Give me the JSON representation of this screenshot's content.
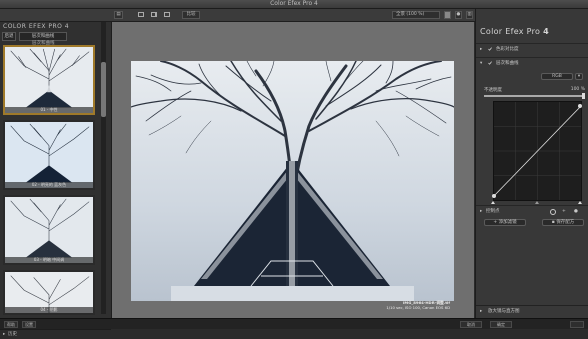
{
  "window": {
    "title": "Color Efex Pro 4"
  },
  "toolbar": {
    "compare_label": "比较",
    "zoom_label": "全景 (100 %)"
  },
  "left_panel": {
    "brand": "COLOR EFEX PRO 4",
    "back_label": "后退",
    "section_label": "层次和曲线",
    "subheading": "层次和曲线",
    "presets": [
      {
        "label": "01 - 中性",
        "selected": true
      },
      {
        "label": "02 - 明亮的 蓝灰色",
        "selected": false
      },
      {
        "label": "03 - 明暗 中间调",
        "selected": false
      },
      {
        "label": "04 - 阴影",
        "selected": false
      }
    ],
    "footer": [
      {
        "label": "配方"
      },
      {
        "label": "历史"
      }
    ]
  },
  "image": {
    "filename": "IMG_8964-HDR-调整.tif",
    "meta": "1/10 sec, ISO 100, Canon EOS 6D"
  },
  "right_panel": {
    "title_prefix": "Color Efex Pro",
    "title_version": "4",
    "filters": [
      {
        "label": "色彩对比度"
      },
      {
        "label": "层次和曲线"
      }
    ],
    "channel_select": "RGB",
    "opacity_label": "不透明度",
    "opacity_value": "100 %",
    "opacity_level": 1.0,
    "control_points_label": "控制点",
    "add_filter_label": "添加滤镜",
    "save_recipe_label": "保存配方",
    "loupe_label": "放大镜与直方图"
  },
  "status_bar": {
    "left_button": "帮助",
    "settings_button": "设置",
    "cancel_button": "取消",
    "ok_button": "确定"
  },
  "colors": {
    "accent": "#a07a2a",
    "panel": "#383838",
    "canvas": "#6f6f6f"
  }
}
